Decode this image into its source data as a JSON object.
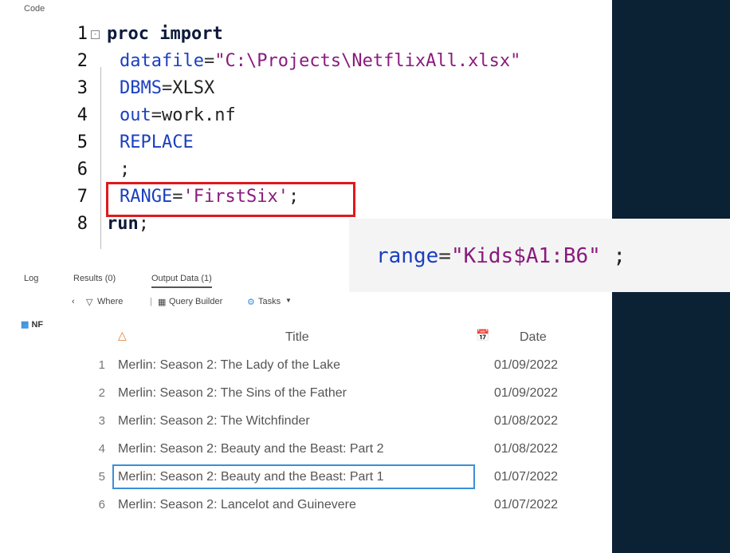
{
  "code_tab": "Code",
  "code_lines": [
    {
      "n": "1",
      "segments": [
        {
          "cls": "kw",
          "t": "proc import"
        }
      ]
    },
    {
      "n": "2",
      "segments": [
        {
          "cls": "opt",
          "t": "datafile"
        },
        {
          "cls": "eq",
          "t": "="
        },
        {
          "cls": "str",
          "t": "\"C:\\Projects\\NetflixAll.xlsx\""
        }
      ]
    },
    {
      "n": "3",
      "segments": [
        {
          "cls": "opt",
          "t": "DBMS"
        },
        {
          "cls": "eq",
          "t": "="
        },
        {
          "cls": "plain",
          "t": "XLSX"
        }
      ]
    },
    {
      "n": "4",
      "segments": [
        {
          "cls": "opt",
          "t": "out"
        },
        {
          "cls": "eq",
          "t": "="
        },
        {
          "cls": "plain",
          "t": "work.nf"
        }
      ]
    },
    {
      "n": "5",
      "segments": [
        {
          "cls": "opt",
          "t": "REPLACE"
        }
      ]
    },
    {
      "n": "6",
      "segments": [
        {
          "cls": "plain",
          "t": ";"
        }
      ]
    },
    {
      "n": "7",
      "segments": [
        {
          "cls": "opt",
          "t": "RANGE"
        },
        {
          "cls": "eq",
          "t": "="
        },
        {
          "cls": "str",
          "t": "'FirstSix'"
        },
        {
          "cls": "plain",
          "t": ";"
        }
      ]
    },
    {
      "n": "8",
      "segments": [
        {
          "cls": "kw",
          "t": "run"
        },
        {
          "cls": "plain",
          "t": ";"
        }
      ]
    }
  ],
  "callout": {
    "segments": [
      {
        "cls": "opt",
        "t": "range"
      },
      {
        "cls": "eq",
        "t": "="
      },
      {
        "cls": "str",
        "t": "\"Kids$A1:B6\""
      },
      {
        "cls": "plain",
        "t": " ;"
      }
    ]
  },
  "bottom_tabs": {
    "log": "Log",
    "results": "Results (0)",
    "output": "Output Data (1)"
  },
  "toolbar": {
    "where": "Where",
    "query_builder": "Query Builder",
    "tasks": "Tasks"
  },
  "sidebar": {
    "dataset": "NF"
  },
  "grid": {
    "col_title": "Title",
    "col_date": "Date",
    "rows": [
      {
        "n": "1",
        "title": "Merlin: Season 2: The Lady of the Lake",
        "date": "01/09/2022"
      },
      {
        "n": "2",
        "title": "Merlin: Season 2: The Sins of the Father",
        "date": "01/09/2022"
      },
      {
        "n": "3",
        "title": "Merlin: Season 2: The Witchfinder",
        "date": "01/08/2022"
      },
      {
        "n": "4",
        "title": "Merlin: Season 2: Beauty and the Beast: Part 2",
        "date": "01/08/2022"
      },
      {
        "n": "5",
        "title": "Merlin: Season 2: Beauty and the Beast: Part 1",
        "date": "01/07/2022"
      },
      {
        "n": "6",
        "title": "Merlin: Season 2: Lancelot and Guinevere",
        "date": "01/07/2022"
      }
    ],
    "selected_row": 5
  },
  "colors": {
    "highlight": "#e0191e",
    "selection": "#3a8fd9",
    "background": "#0b2235"
  }
}
